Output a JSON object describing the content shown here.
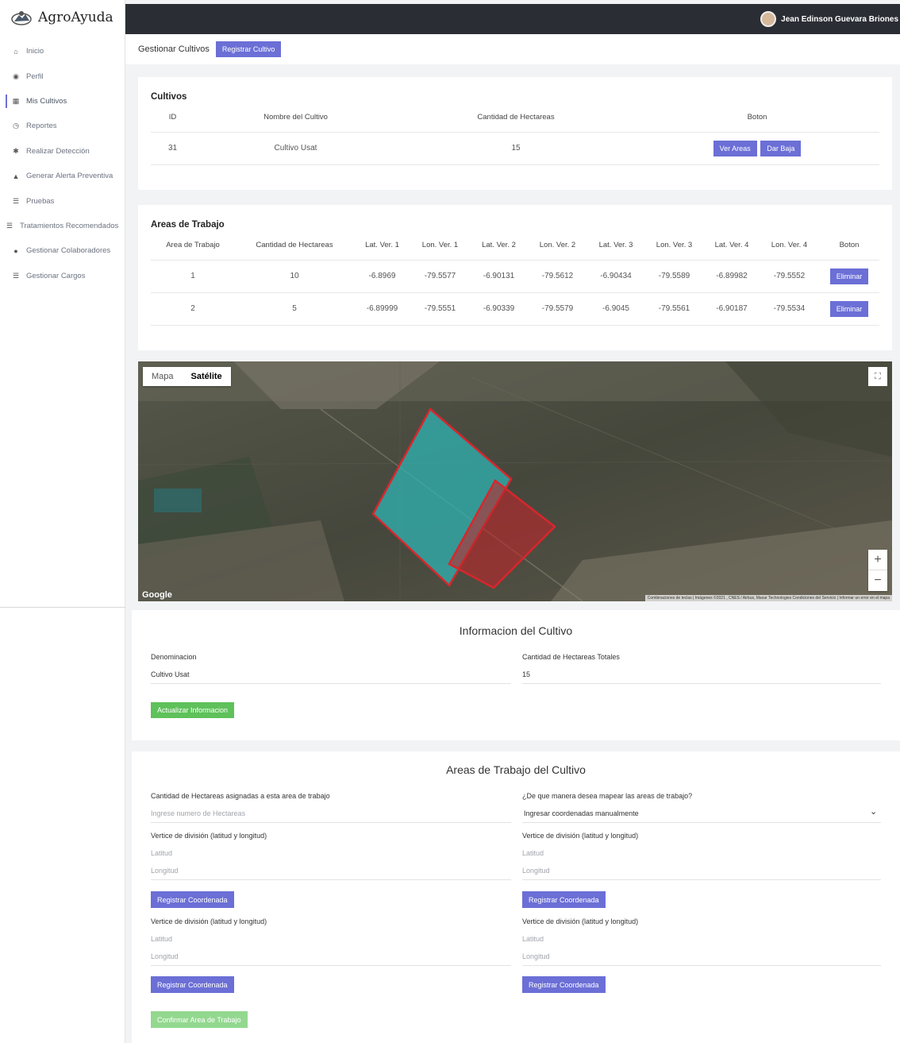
{
  "sidebar": {
    "brand": "AgroAyuda",
    "items": [
      {
        "label": "Inicio",
        "icon": "⌂"
      },
      {
        "label": "Perfil",
        "icon": "◉"
      },
      {
        "label": "Mis Cultivos",
        "icon": "▦"
      },
      {
        "label": "Reportes",
        "icon": "◷"
      },
      {
        "label": "Realizar Detección",
        "icon": "✱"
      },
      {
        "label": "Generar Alerta Preventiva",
        "icon": "▲"
      },
      {
        "label": "Pruebas",
        "icon": "☰"
      },
      {
        "label": "Tratamientos Recomendados",
        "icon": "☰"
      },
      {
        "label": "Gestionar Colaboradores",
        "icon": "●"
      },
      {
        "label": "Gestionar Cargos",
        "icon": "☰"
      }
    ]
  },
  "topbar": {
    "user_name": "Jean Edinson Guevara Briones"
  },
  "subheader": {
    "title": "Gestionar Cultivos",
    "register_button": "Registrar Cultivo"
  },
  "cultivos": {
    "title": "Cultivos",
    "headers": [
      "ID",
      "Nombre del Cultivo",
      "Cantidad de Hectareas",
      "Boton"
    ],
    "rows": [
      {
        "id": "31",
        "name": "Cultivo Usat",
        "hectares": "15",
        "btn_areas": "Ver Areas",
        "btn_baja": "Dar Baja"
      }
    ]
  },
  "areas": {
    "title": "Areas de Trabajo",
    "headers": [
      "Area de Trabajo",
      "Cantidad de Hectareas",
      "Lat. Ver. 1",
      "Lon. Ver. 1",
      "Lat. Ver. 2",
      "Lon. Ver. 2",
      "Lat. Ver. 3",
      "Lon. Ver. 3",
      "Lat. Ver. 4",
      "Lon. Ver. 4",
      "Boton"
    ],
    "rows": [
      {
        "cells": [
          "1",
          "10",
          "-6.8969",
          "-79.5577",
          "-6.90131",
          "-79.5612",
          "-6.90434",
          "-79.5589",
          "-6.89982",
          "-79.5552"
        ],
        "button": "Eliminar"
      },
      {
        "cells": [
          "2",
          "5",
          "-6.89999",
          "-79.5551",
          "-6.90339",
          "-79.5579",
          "-6.9045",
          "-79.5561",
          "-6.90187",
          "-79.5534"
        ],
        "button": "Eliminar"
      }
    ]
  },
  "map": {
    "tab_map": "Mapa",
    "tab_satellite": "Satélite",
    "zoom_in": "+",
    "zoom_out": "−",
    "logo": "Google",
    "attribution": "Combinaciones de teclas | Imágenes ©2021 , CNES / Airbus, Maxar Technologies   Condiciones del Servicio | Informar un error en el mapa",
    "area_colors": [
      "#2fb3b3",
      "#c0262b"
    ]
  },
  "info": {
    "title": "Informacion del Cultivo",
    "denominacion_label": "Denominacion",
    "denominacion_value": "Cultivo Usat",
    "hectareas_label": "Cantidad de Hectareas Totales",
    "hectareas_value": "15",
    "update_button": "Actualizar Informacion"
  },
  "work_areas_form": {
    "title": "Areas de Trabajo del Cultivo",
    "hectares_label": "Cantidad de Hectareas asignadas a esta area de trabajo",
    "hectares_placeholder": "Ingrese numero de Hectareas",
    "mapping_label": "¿De que manera desea mapear las areas de trabajo?",
    "mapping_selected": "Ingresar coordenadas manualmente",
    "vertex_label": "Vertice de división (latitud y longitud)",
    "lat_placeholder": "Latitud",
    "lon_placeholder": "Longitud",
    "register_button": "Registrar Coordenada",
    "confirm_button": "Confirmar Area de Trabajo"
  }
}
